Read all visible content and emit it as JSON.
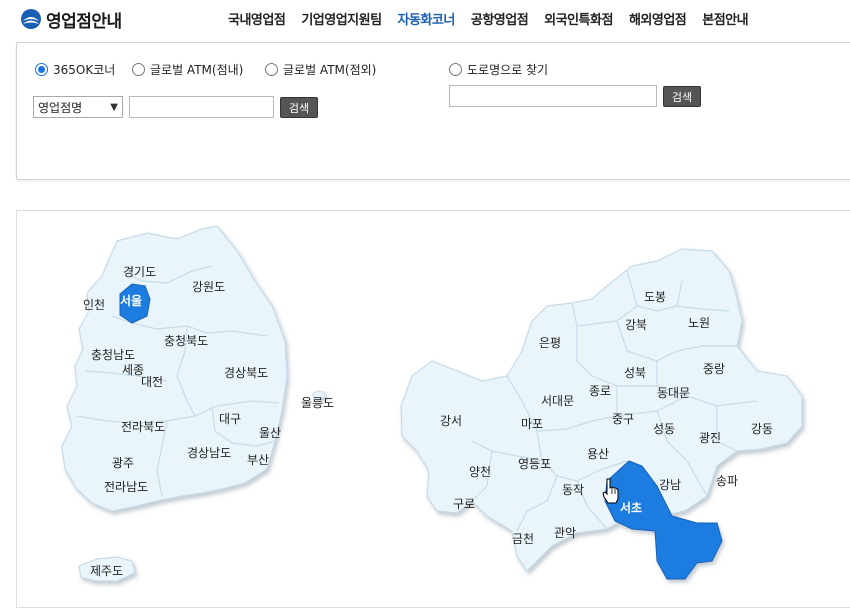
{
  "header": {
    "logo_text": "영업점안내",
    "nav": [
      "국내영업점",
      "기업영업지원팀",
      "자동화코너",
      "공항영업점",
      "외국인특화점",
      "해외영업점",
      "본점안내"
    ],
    "active_index": 2
  },
  "search": {
    "radios": [
      "365OK코너",
      "글로벌 ATM(점내)",
      "글로벌 ATM(점외)"
    ],
    "road_radio": "도로명으로 찾기",
    "select_value": "영업점명",
    "search_button": "검색",
    "road_search_button": "검색"
  },
  "korea_map": {
    "regions": [
      "경기도",
      "인천",
      "서울",
      "강원도",
      "충청북도",
      "충청남도",
      "세종",
      "대전",
      "경상북도",
      "울릉도",
      "대구",
      "울산",
      "전라북도",
      "경상남도",
      "부산",
      "광주",
      "전라남도",
      "제주도"
    ],
    "selected": "서울"
  },
  "seoul_map": {
    "districts": [
      "도봉",
      "노원",
      "강북",
      "은평",
      "성북",
      "중랑",
      "종로",
      "동대문",
      "서대문",
      "중구",
      "강서",
      "마포",
      "성동",
      "광진",
      "강동",
      "용산",
      "양천",
      "영등포",
      "강남",
      "송파",
      "구로",
      "동작",
      "서초",
      "금천",
      "관악"
    ],
    "selected": "서초"
  },
  "colors": {
    "accent": "#1a73e8",
    "nav_active": "#1a5fb4",
    "map_fill": "#eaf5fb",
    "map_stroke": "#c7dbe8",
    "selected_fill": "#1f7be0"
  }
}
